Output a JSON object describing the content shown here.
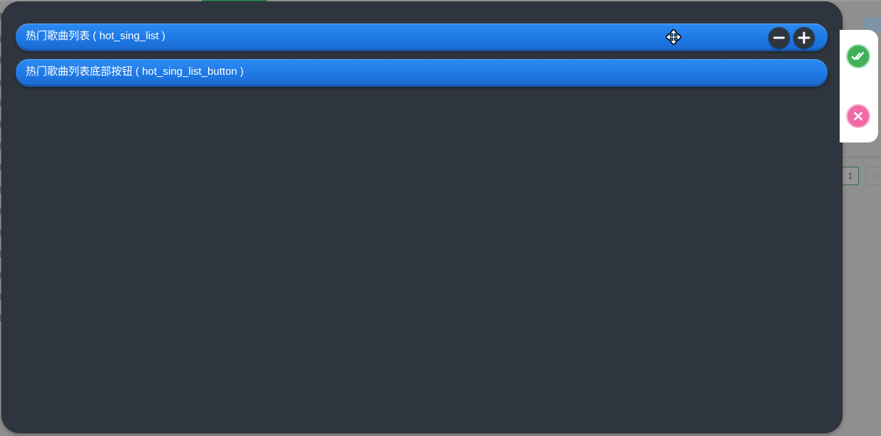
{
  "rows": [
    {
      "label": "热门歌曲列表 ( hot_sing_list )"
    },
    {
      "label": "热门歌曲列表底部按钮 ( hot_sing_list_button )"
    }
  ],
  "controls": {
    "move_icon": "move-icon",
    "minus_icon": "minus-icon",
    "plus_icon": "plus-icon"
  },
  "side_actions": {
    "confirm_icon": "double-check-icon",
    "cancel_icon": "close-icon"
  },
  "pagination": {
    "current_page": "1",
    "next_glyph": "›"
  },
  "colors": {
    "panel": "#2f353e",
    "row_blue": "#1f7ae6",
    "confirm_green": "#3fb257",
    "cancel_pink": "#f06aa6"
  }
}
